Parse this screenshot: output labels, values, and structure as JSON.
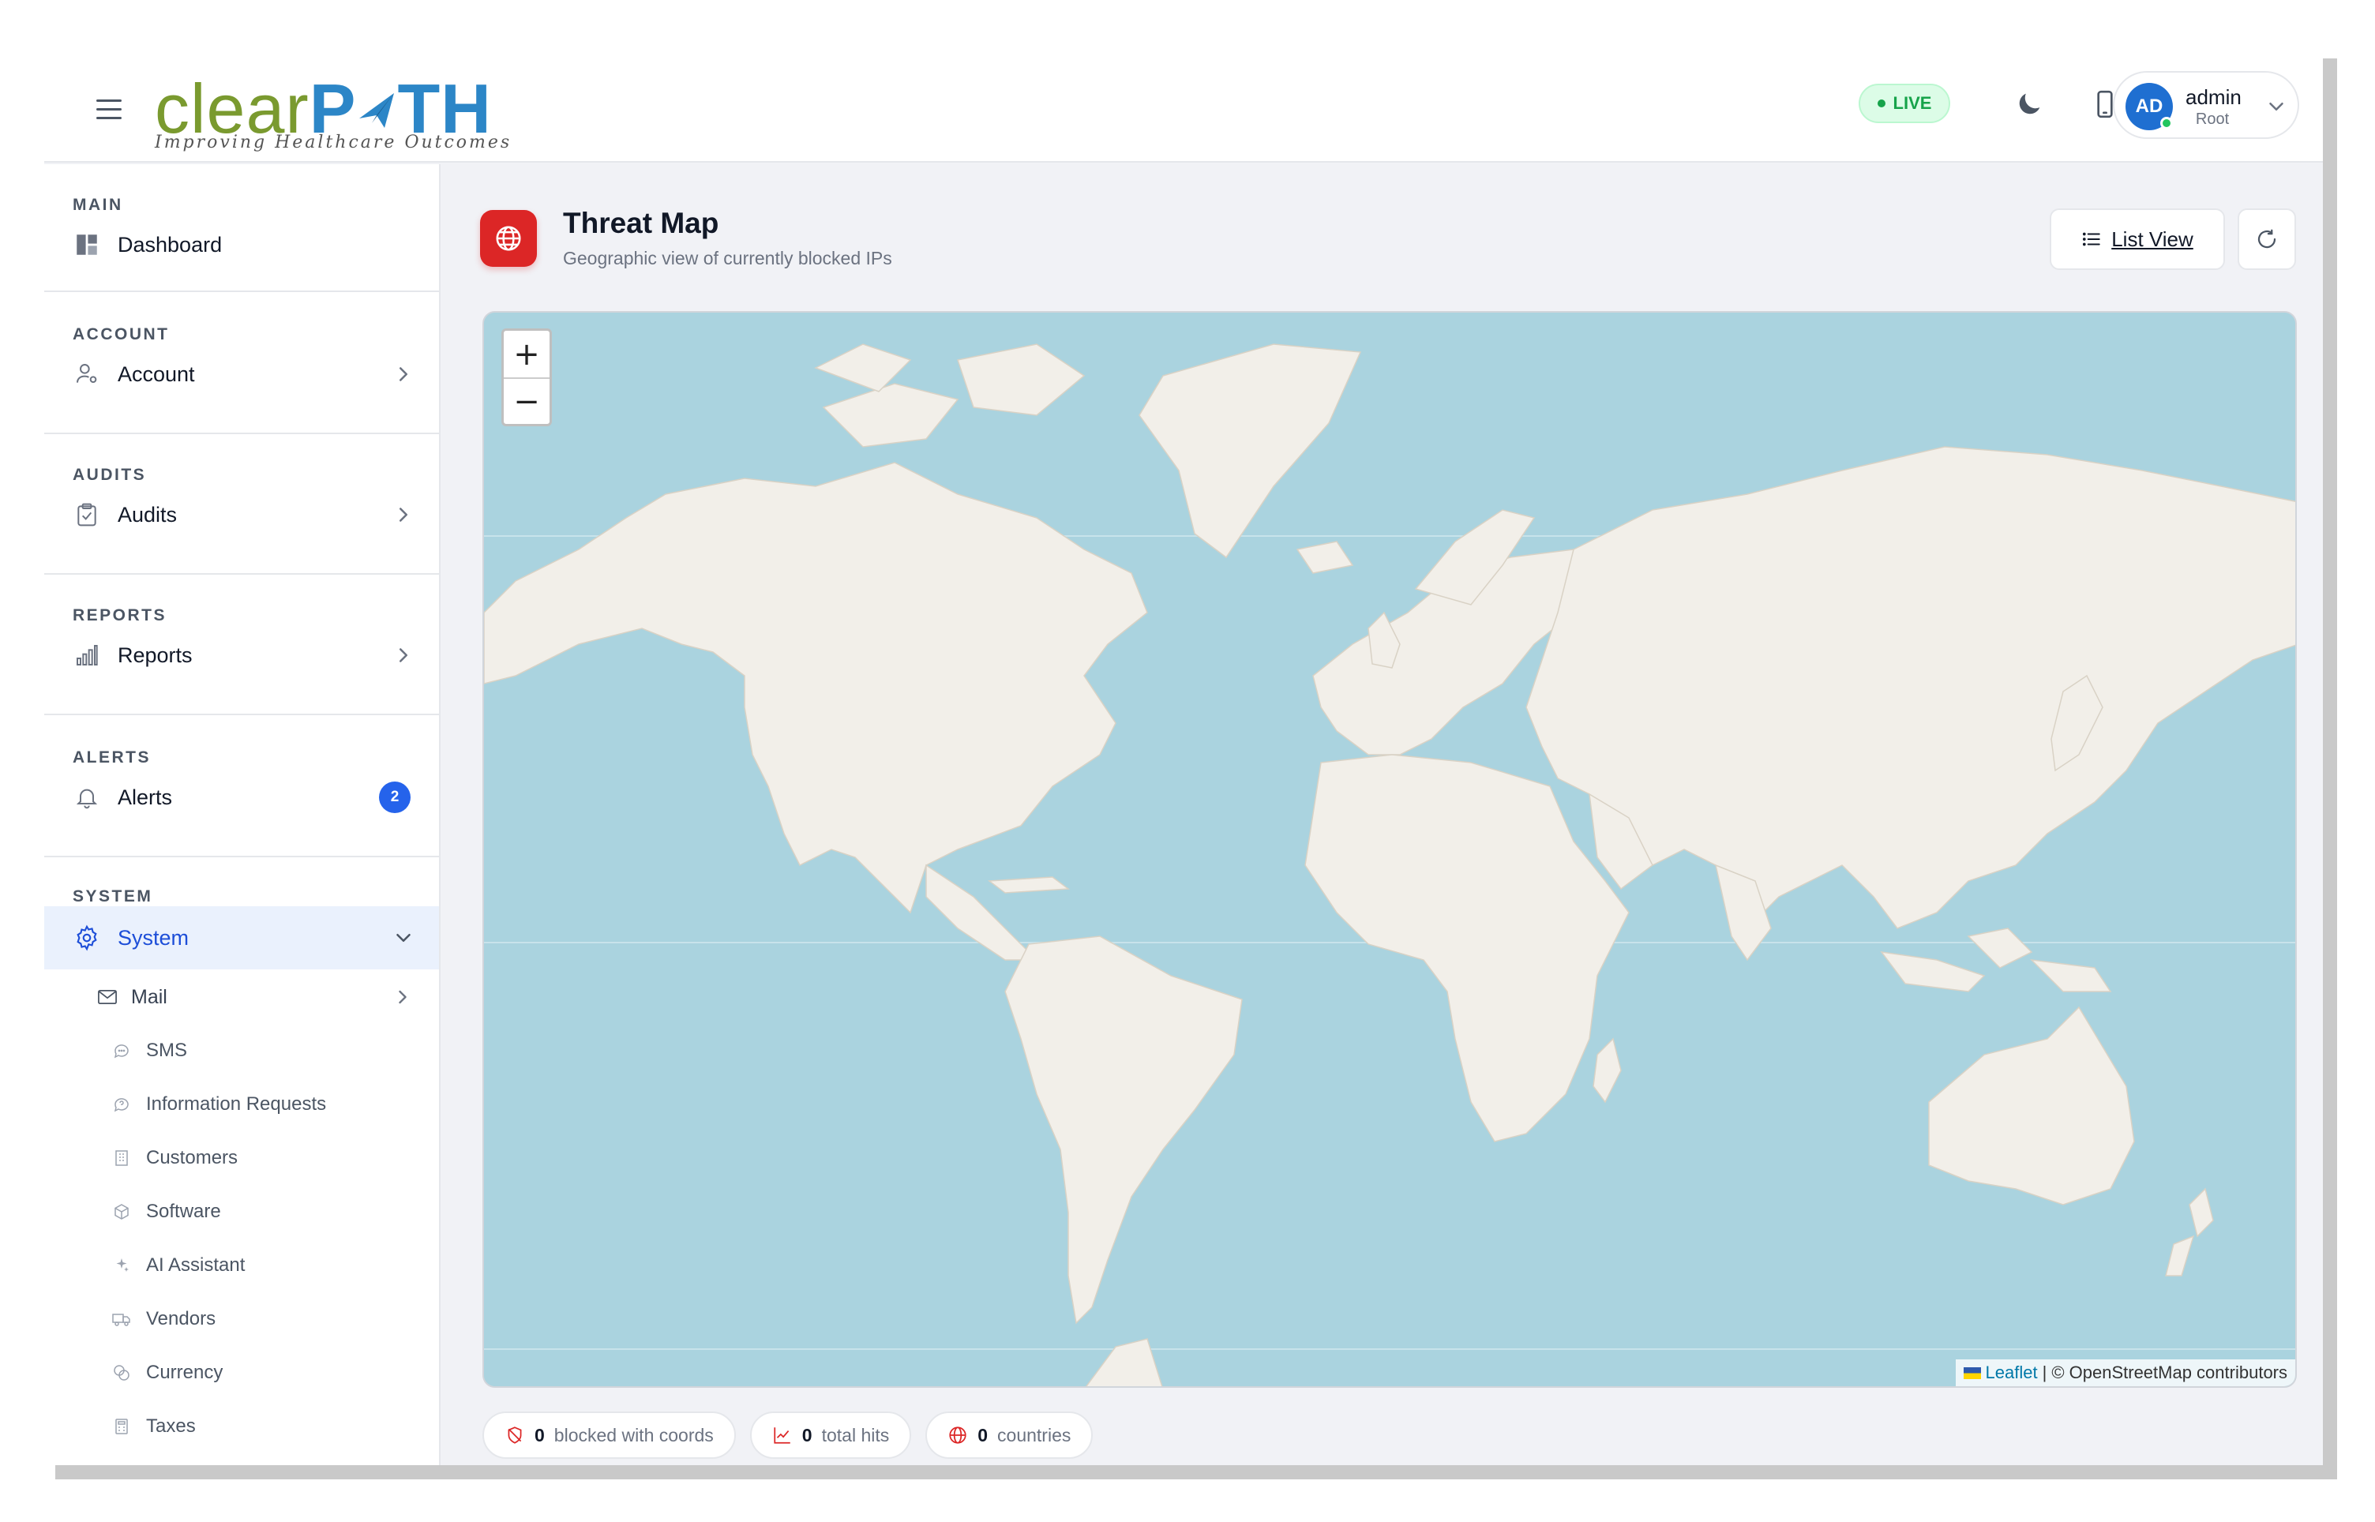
{
  "header": {
    "logo_clear": "clear",
    "logo_path": "P",
    "logo_path_rest": "TH",
    "logo_tagline": "Improving Healthcare Outcomes",
    "live_label": "LIVE",
    "user": {
      "initials": "AD",
      "name": "admin",
      "role": "Root"
    }
  },
  "sidebar": {
    "sections": {
      "main": "MAIN",
      "account": "ACCOUNT",
      "audits": "AUDITS",
      "reports": "REPORTS",
      "alerts": "ALERTS",
      "system": "SYSTEM"
    },
    "items": {
      "dashboard": "Dashboard",
      "account": "Account",
      "audits": "Audits",
      "reports": "Reports",
      "alerts": "Alerts",
      "alerts_badge": "2",
      "system": "System",
      "mail": "Mail",
      "sms": "SMS",
      "information_requests": "Information Requests",
      "customers": "Customers",
      "software": "Software",
      "ai_assistant": "AI Assistant",
      "vendors": "Vendors",
      "currency": "Currency",
      "taxes": "Taxes"
    }
  },
  "page": {
    "title": "Threat Map",
    "subtitle": "Geographic view of currently blocked IPs",
    "list_view_label": "List View"
  },
  "map": {
    "zoom_in": "+",
    "zoom_out": "−",
    "attribution_leaflet": "Leaflet",
    "attribution_sep": "|",
    "attribution_osm": "© OpenStreetMap contributors"
  },
  "stats": {
    "blocked_count": "0",
    "blocked_label": "blocked with coords",
    "hits_count": "0",
    "hits_label": "total hits",
    "countries_count": "0",
    "countries_label": "countries"
  },
  "colors": {
    "brand_blue": "#2c86c7",
    "brand_green": "#7a9a2f",
    "accent": "#2563eb",
    "danger": "#dc2626",
    "live_green": "#16a34a",
    "ocean": "#aad3df",
    "land": "#f2efe9"
  }
}
